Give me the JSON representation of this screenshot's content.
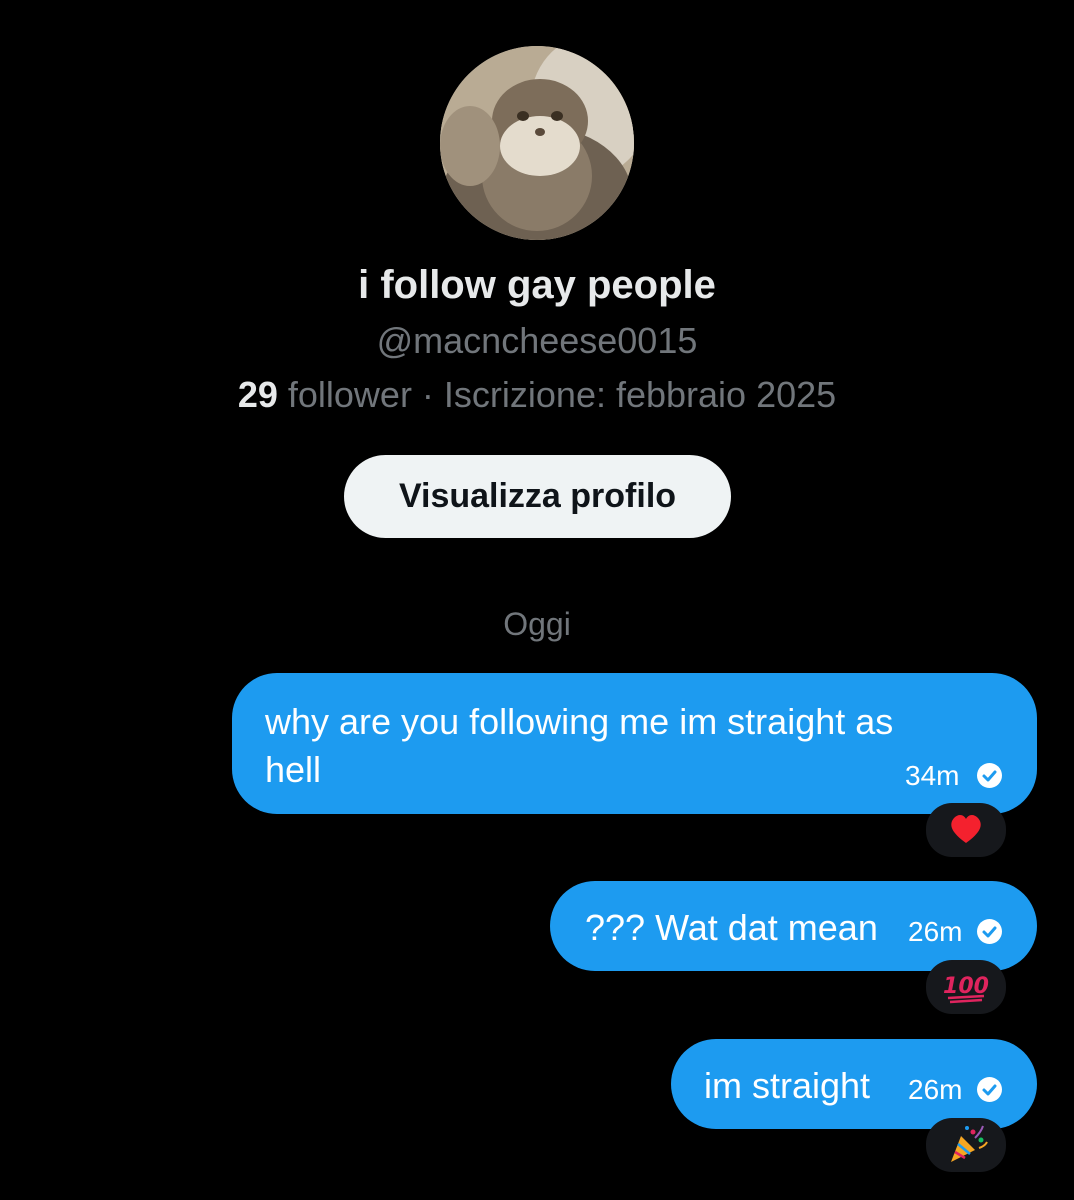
{
  "profile": {
    "display_name": "i follow gay people",
    "handle": "@macncheese0015",
    "follower_count": "29",
    "follower_label": " follower · Iscrizione: febbraio 2025",
    "view_profile_label": "Visualizza profilo"
  },
  "conversation": {
    "date_separator": "Oggi",
    "messages": [
      {
        "line1": "why are you following me im straight as",
        "line2": "hell",
        "time": "34m",
        "reaction": "heart"
      },
      {
        "text": "??? Wat dat mean",
        "time": "26m",
        "reaction": "hundred-points"
      },
      {
        "text": "im straight",
        "time": "26m",
        "reaction": "party-popper"
      }
    ],
    "reaction_labels": {
      "hundred": "100"
    }
  },
  "colors": {
    "background": "#000000",
    "bubble": "#1d9bf0",
    "muted_text": "#71767b",
    "primary_text": "#e7e9ea",
    "reaction_bg": "#16181c",
    "heart": "#f4212e"
  }
}
